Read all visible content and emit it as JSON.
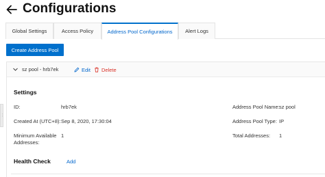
{
  "header": {
    "title": "Configurations"
  },
  "tabs": [
    {
      "label": "Global Settings",
      "active": false
    },
    {
      "label": "Access Policy",
      "active": false
    },
    {
      "label": "Address Pool Configurations",
      "active": true
    },
    {
      "label": "Alert Logs",
      "active": false
    }
  ],
  "toolbar": {
    "create_label": "Create Address Pool"
  },
  "pool": {
    "name": "sz pool - hrb7ek",
    "edit_label": "Edit",
    "delete_label": "Delete"
  },
  "settings": {
    "title": "Settings",
    "left": [
      {
        "label": "ID:",
        "value": "hrb7ek"
      },
      {
        "label": "Created At (UTC+8):",
        "value": "Sep 8, 2020, 17:30:04"
      },
      {
        "label": "Minimum Available\nAddresses:",
        "value": "1"
      }
    ],
    "right": [
      {
        "label": "Address Pool Name:",
        "value": "sz pool"
      },
      {
        "label": "Address Pool Type:",
        "value": "IP"
      },
      {
        "label": "Total Addresses:",
        "value": "1"
      }
    ]
  },
  "health_check": {
    "title": "Health Check",
    "add_label": "Add"
  },
  "colors": {
    "accent": "#0070cc",
    "link": "#0066cc",
    "danger": "#d93026"
  },
  "icons": [
    "back-arrow-icon",
    "chevron-down-icon",
    "pencil-icon",
    "trash-icon"
  ]
}
